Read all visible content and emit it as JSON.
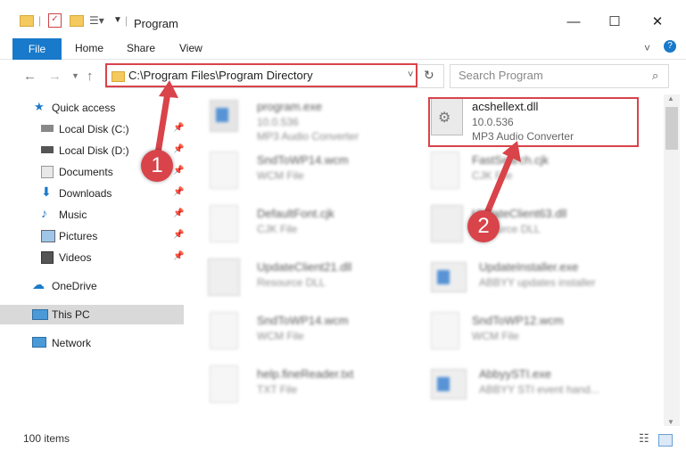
{
  "window": {
    "title": "Program"
  },
  "ribbon": {
    "file": "File",
    "tabs": [
      "Home",
      "Share",
      "View"
    ]
  },
  "address": {
    "path": "C:\\Program Files\\Program Directory"
  },
  "search": {
    "placeholder": "Search Program"
  },
  "sidebar": {
    "items": [
      {
        "label": "Quick access",
        "icon": "star-icon"
      },
      {
        "label": "Local Disk (C:)",
        "icon": "drive-icon"
      },
      {
        "label": "Local Disk (D:)",
        "icon": "drive-icon"
      },
      {
        "label": "Documents",
        "icon": "documents-icon"
      },
      {
        "label": "Downloads",
        "icon": "download-icon"
      },
      {
        "label": "Music",
        "icon": "music-icon"
      },
      {
        "label": "Pictures",
        "icon": "pictures-icon"
      },
      {
        "label": "Videos",
        "icon": "videos-icon"
      },
      {
        "label": "OneDrive",
        "icon": "cloud-icon"
      },
      {
        "label": "This PC",
        "icon": "pc-icon"
      },
      {
        "label": "Network",
        "icon": "network-icon"
      }
    ]
  },
  "files": [
    {
      "name": "program.exe",
      "sub": "10.0.536",
      "sub2": "MP3 Audio Converter"
    },
    {
      "name": "acshellext.dll",
      "sub": "10.0.536",
      "sub2": "MP3 Audio Converter"
    },
    {
      "name": "SndToWP14.wcm",
      "sub": "WCM File"
    },
    {
      "name": "FastSearch.cjk",
      "sub": "CJK File"
    },
    {
      "name": "DefaultFont.cjk",
      "sub": "CJK File"
    },
    {
      "name": "UpdateClient63.dll",
      "sub": "Resource DLL"
    },
    {
      "name": "UpdateClient21.dll",
      "sub": "Resource DLL"
    },
    {
      "name": "UpdateInstaller.exe",
      "sub": "ABBYY updates installer"
    },
    {
      "name": "SndToWP14.wcm",
      "sub": "WCM File"
    },
    {
      "name": "SndToWP12.wcm",
      "sub": "WCM File"
    },
    {
      "name": "help.fineReader.txt",
      "sub": "TXT File"
    },
    {
      "name": "AbbyySTI.exe",
      "sub": "ABBYY STI event hand..."
    }
  ],
  "status": {
    "count": "100 items"
  },
  "markers": [
    "1",
    "2"
  ],
  "colors": {
    "accent": "#1979ca",
    "highlight": "#d9434a"
  }
}
